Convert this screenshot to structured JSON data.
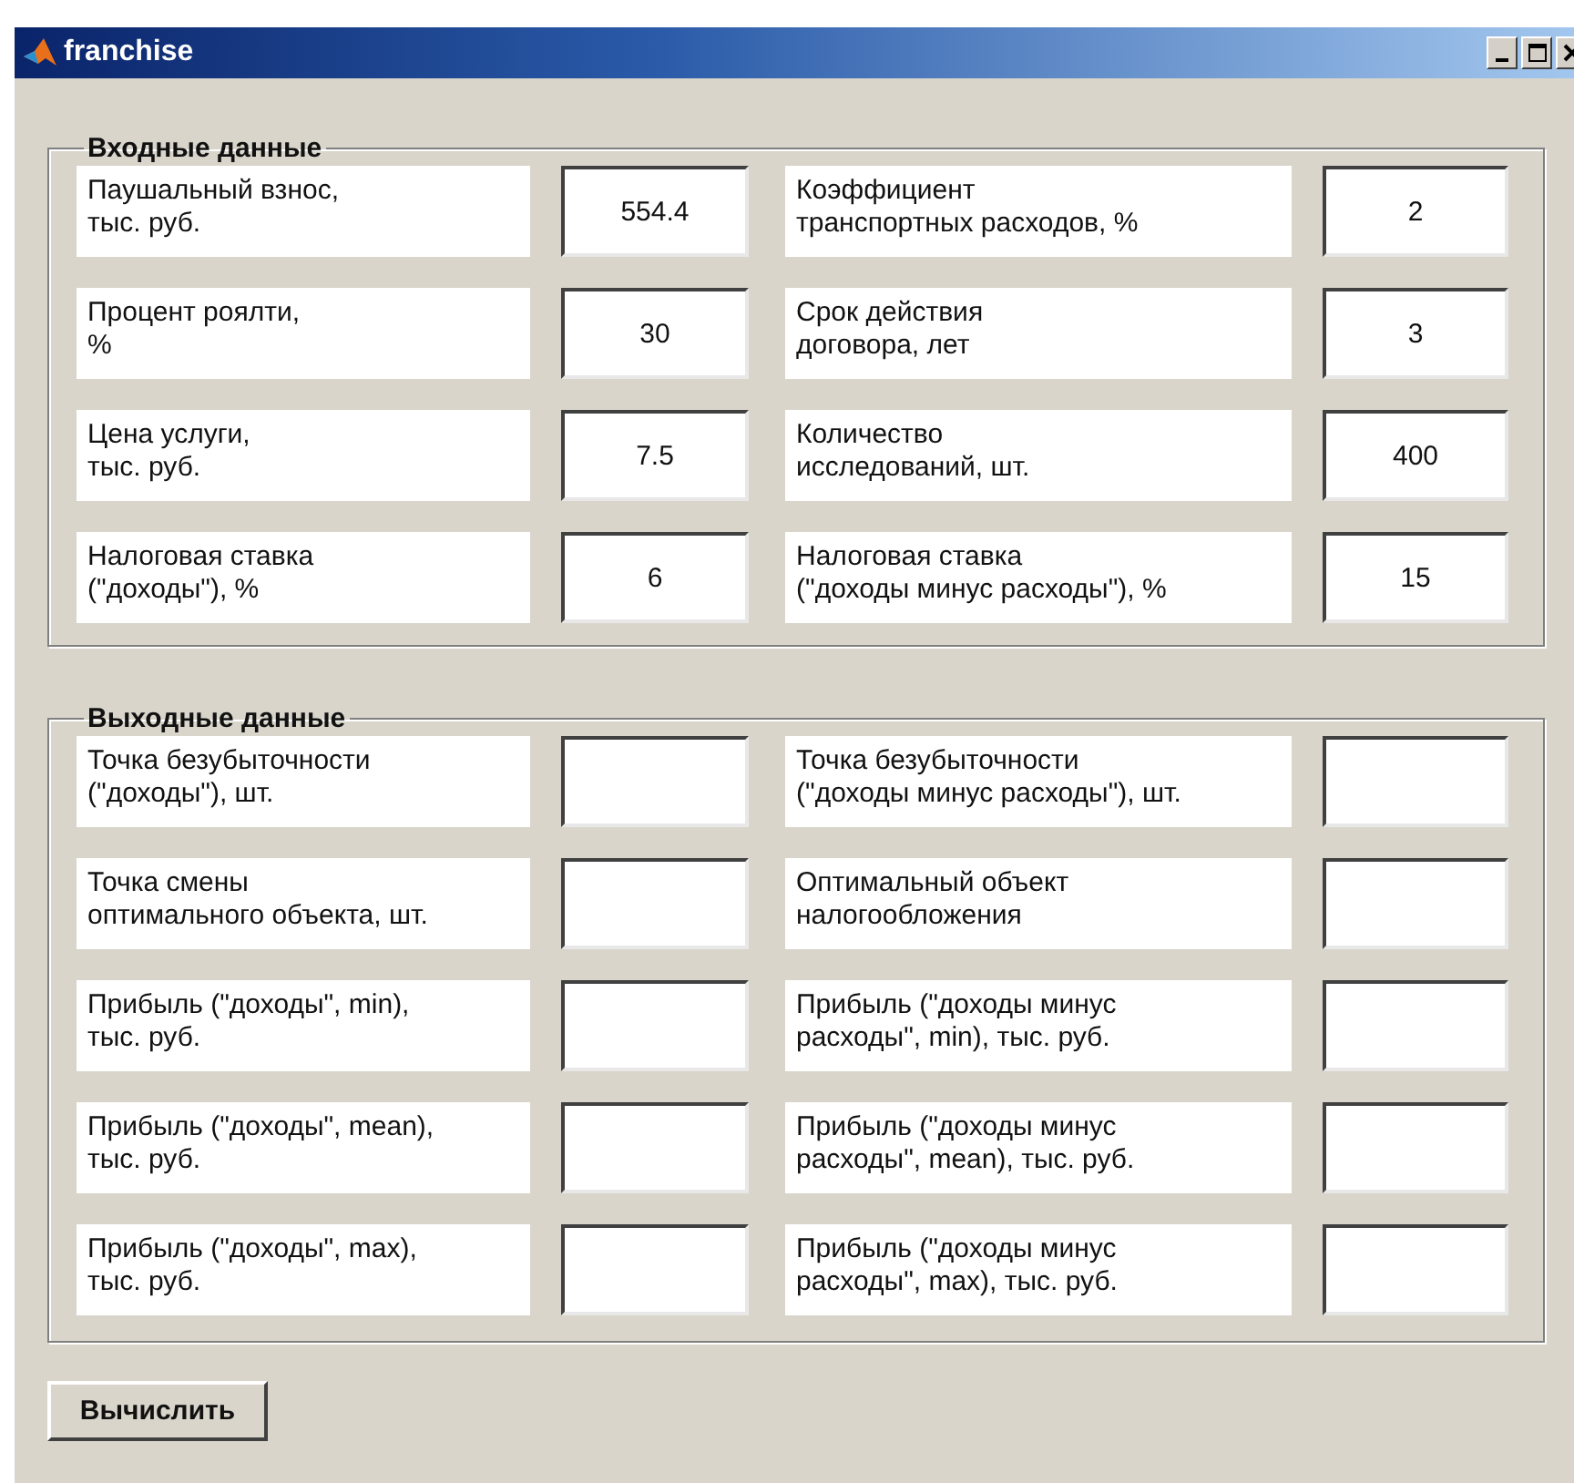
{
  "window": {
    "title": "franchise"
  },
  "input_group": {
    "title": "Входные данные",
    "fields": [
      {
        "label": "Паушальный взнос,\nтыс. руб.",
        "value": "554.4"
      },
      {
        "label": "Коэффициент\nтранспортных расходов, %",
        "value": "2"
      },
      {
        "label": "Процент роялти,\n%",
        "value": "30"
      },
      {
        "label": "Срок действия\nдоговора, лет",
        "value": "3"
      },
      {
        "label": "Цена услуги,\nтыс. руб.",
        "value": "7.5"
      },
      {
        "label": "Количество\nисследований, шт.",
        "value": "400"
      },
      {
        "label": "Налоговая ставка\n(\"доходы\"), %",
        "value": "6"
      },
      {
        "label": "Налоговая ставка\n(\"доходы минус расходы\"), %",
        "value": "15"
      }
    ]
  },
  "output_group": {
    "title": "Выходные данные",
    "fields": [
      {
        "label": "Точка безубыточности\n(\"доходы\"), шт."
      },
      {
        "label": "Точка безубыточности\n(\"доходы минус расходы\"), шт."
      },
      {
        "label": "Точка смены\nоптимального объекта, шт."
      },
      {
        "label": "Оптимальный объект\nналогообложения"
      },
      {
        "label": "Прибыль (\"доходы\", min),\nтыс. руб."
      },
      {
        "label": "Прибыль (\"доходы минус\nрасходы\", min), тыс. руб."
      },
      {
        "label": "Прибыль (\"доходы\", mean),\nтыс. руб."
      },
      {
        "label": "Прибыль (\"доходы минус\nрасходы\", mean), тыс. руб."
      },
      {
        "label": "Прибыль (\"доходы\", max),\nтыс. руб."
      },
      {
        "label": "Прибыль (\"доходы минус\nрасходы\", max), тыс. руб."
      }
    ]
  },
  "buttons": [
    {
      "label": "Вычислить"
    }
  ]
}
